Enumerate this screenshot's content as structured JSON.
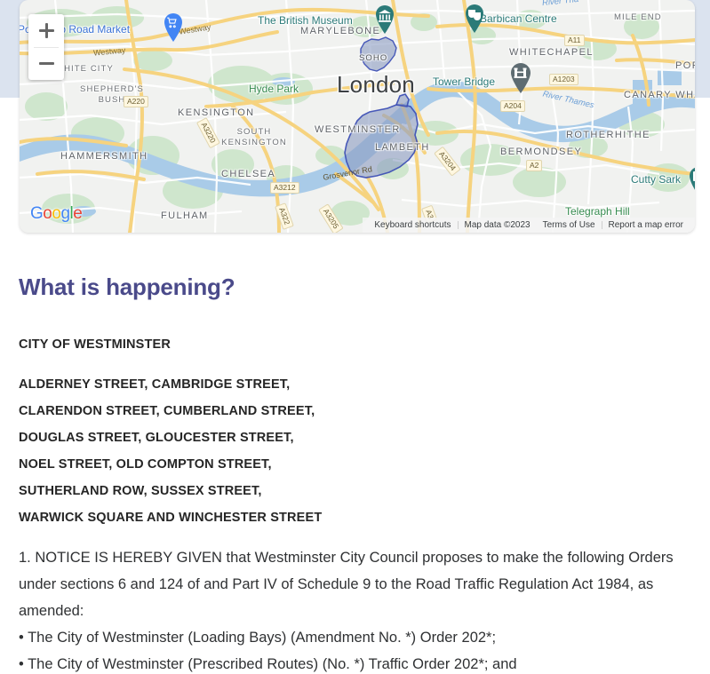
{
  "map": {
    "zoom_in_label": "+",
    "zoom_out_label": "−",
    "logo_letters": [
      "G",
      "o",
      "o",
      "g",
      "l",
      "e"
    ],
    "attribution": {
      "keyboard_shortcuts": "Keyboard shortcuts",
      "map_data": "Map data ©2023",
      "terms": "Terms of Use",
      "report": "Report a map error"
    },
    "labels": {
      "city": "London",
      "areas": [
        "MARYLEBONE",
        "WHITECHAPEL",
        "MILE END",
        "WESTMINSTER",
        "LAMBETH",
        "BERMONDSEY",
        "ROTHERHITHE",
        "CANARY WHARF",
        "KENSINGTON",
        "SOUTH KENSINGTON",
        "CHELSEA",
        "FULHAM",
        "HAMMERSMITH",
        "SHEPHERD'S BUSH",
        "WHITE CITY",
        "SOHO",
        "POP"
      ],
      "pois": [
        "Portobello Road Market",
        "The British Museum",
        "Barbican Centre",
        "Tower Bridge",
        "Cutty Sark",
        "Hyde Park",
        "Telegraph Hill"
      ],
      "water": [
        "River Thames",
        "River Tha"
      ],
      "roads": [
        "Westway",
        "Westway",
        "A11",
        "A1203",
        "A2",
        "A3204",
        "A3",
        "A3220",
        "A3212",
        "A322",
        "A3205",
        "A220",
        "Grosvenor Rd",
        "A204"
      ]
    },
    "colors": {
      "land": "#f1f2f0",
      "park": "#cfe6cd",
      "water": "#a9cbe8",
      "road_major": "#f6d37f",
      "road_minor": "#ffffff",
      "highlight_fill": "#8e9ec4",
      "highlight_stroke": "#3f51b5",
      "band": "#dbe3ef"
    }
  },
  "content": {
    "heading": "What is happening?",
    "authority": "CITY OF WESTMINSTER",
    "street_lines": [
      "ALDERNEY STREET, CAMBRIDGE STREET,",
      "CLARENDON STREET, CUMBERLAND STREET,",
      "DOUGLAS STREET, GLOUCESTER STREET,",
      "NOEL STREET, OLD COMPTON STREET,",
      "SUTHERLAND ROW, SUSSEX STREET,",
      "WARWICK SQUARE AND WINCHESTER STREET"
    ],
    "notice_paragraph": "1. NOTICE IS HEREBY GIVEN that Westminster City Council proposes to make the following Orders under sections 6 and 124 of and Part IV of Schedule 9 to the Road Traffic Regulation Act 1984, as amended:",
    "orders": [
      "• The City of Westminster (Loading Bays) (Amendment No. *) Order 202*;",
      "• The City of Westminster (Prescribed Routes) (No. *) Traffic Order 202*; and"
    ],
    "heading_color": "#4a4a8a"
  }
}
